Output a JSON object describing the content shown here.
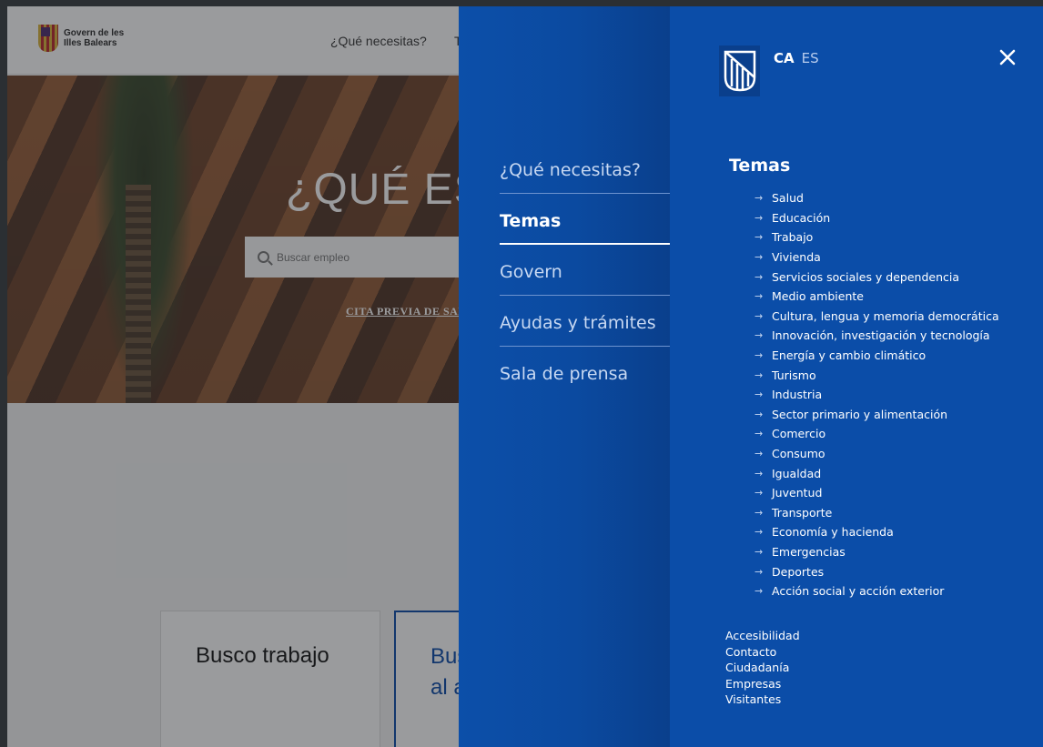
{
  "background": {
    "logo_line1": "Govern de les",
    "logo_line2": "Illes Balears",
    "nav_item_1": "¿Qué necesitas?",
    "nav_item_2": "T",
    "hero_title": "¿QUÉ EST",
    "search_placeholder": "Buscar empleo",
    "cita_link": "CITA PREVIA DE SAL",
    "card_1_title": "Busco trabajo",
    "card_2_title_line1": "Bus",
    "card_2_title_line2": "al a"
  },
  "menu": {
    "languages": {
      "active": "CA",
      "other": "ES"
    },
    "main_nav": [
      {
        "label": "¿Qué necesitas?",
        "active": false
      },
      {
        "label": "Temas",
        "active": true
      },
      {
        "label": "Govern",
        "active": false
      },
      {
        "label": "Ayudas y trámites",
        "active": false
      },
      {
        "label": "Sala de prensa",
        "active": false
      }
    ],
    "temas": {
      "title": "Temas",
      "items": [
        "Salud",
        "Educación",
        "Trabajo",
        "Vivienda",
        "Servicios sociales y dependencia",
        "Medio ambiente",
        "Cultura, lengua y memoria democrática",
        "Innovación, investigación y tecnología",
        "Energía y cambio climático",
        "Turismo",
        "Industria",
        "Sector primario y alimentación",
        "Comercio",
        "Consumo",
        "Igualdad",
        "Juventud",
        "Transporte",
        "Economía y hacienda",
        "Emergencias",
        "Deportes",
        "Acción social y acción exterior"
      ]
    },
    "footer_links": [
      "Accesibilidad",
      "Contacto",
      "Ciudadanía",
      "Empresas",
      "Visitantes"
    ]
  },
  "colors": {
    "menu_blue": "#0b4da8",
    "menu_blue_dark": "#0a3f8c",
    "text_white": "#ffffff",
    "muted_text": "#c7d8f2"
  },
  "icons": {
    "close": "close-icon",
    "arrow": "arrow-right-icon",
    "search": "search-icon",
    "logo": "balearic-shield-logo-icon"
  }
}
